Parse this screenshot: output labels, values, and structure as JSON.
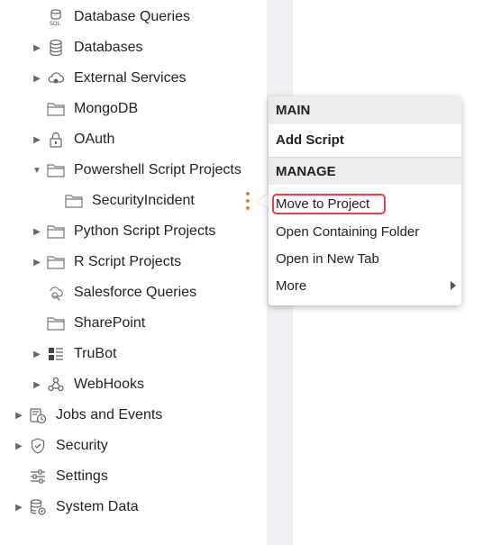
{
  "tree": {
    "items": [
      {
        "label": "Database Queries",
        "icon": "sql-icon"
      },
      {
        "label": "Databases",
        "icon": "database-icon"
      },
      {
        "label": "External Services",
        "icon": "cloud-icon"
      },
      {
        "label": "MongoDB",
        "icon": "folder-icon"
      },
      {
        "label": "OAuth",
        "icon": "lock-icon"
      },
      {
        "label": "Powershell Script Projects",
        "icon": "folder-icon"
      },
      {
        "label": "SecurityIncident",
        "icon": "folder-icon"
      },
      {
        "label": "Python Script Projects",
        "icon": "folder-icon"
      },
      {
        "label": "R Script Projects",
        "icon": "folder-icon"
      },
      {
        "label": "Salesforce Queries",
        "icon": "query-icon"
      },
      {
        "label": "SharePoint",
        "icon": "folder-icon"
      },
      {
        "label": "TruBot",
        "icon": "trubot-icon"
      },
      {
        "label": "WebHooks",
        "icon": "webhook-icon"
      },
      {
        "label": "Jobs and Events",
        "icon": "jobs-events-icon"
      },
      {
        "label": "Security",
        "icon": "shield-icon"
      },
      {
        "label": "Settings",
        "icon": "sliders-icon"
      },
      {
        "label": "System Data",
        "icon": "system-data-icon"
      }
    ]
  },
  "context_menu": {
    "main_header": "MAIN",
    "add_script": "Add Script",
    "manage_header": "MANAGE",
    "move_to_project": "Move to Project",
    "open_containing_folder": "Open Containing Folder",
    "open_in_new_tab": "Open in New Tab",
    "more": "More"
  },
  "colors": {
    "kebab": "#f07f1e",
    "highlight": "#e2424b",
    "strip": "#eef0f4"
  }
}
